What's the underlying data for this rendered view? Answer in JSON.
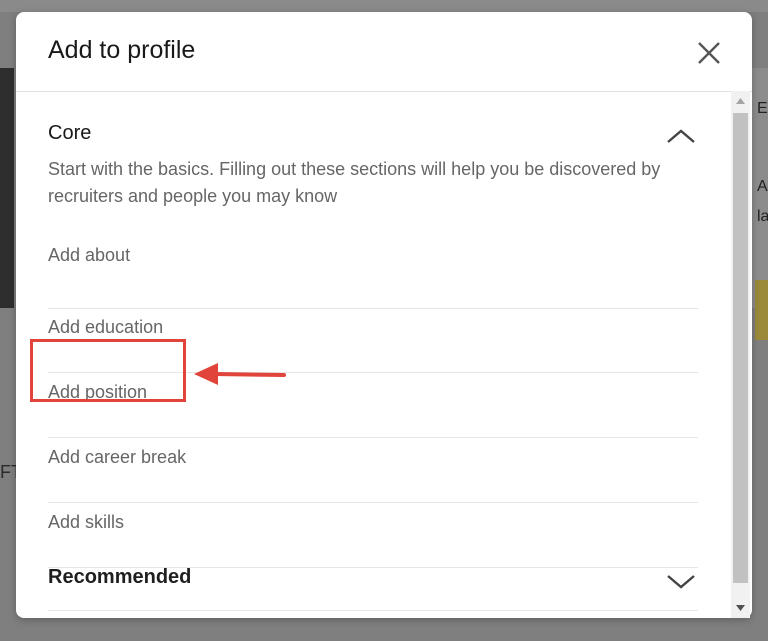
{
  "dialog": {
    "title": "Add to profile",
    "close_icon": "close-icon"
  },
  "core": {
    "title": "Core",
    "description": "Start with the basics. Filling out these sections will help you be discovered by recruiters and people you may know",
    "expanded": true,
    "items": [
      {
        "label": "Add about"
      },
      {
        "label": "Add education"
      },
      {
        "label": "Add position"
      },
      {
        "label": "Add career break"
      },
      {
        "label": "Add skills"
      }
    ]
  },
  "recommended": {
    "title": "Recommended",
    "expanded": false
  },
  "annotation": {
    "highlighted_item": "Add position",
    "color": "#e0443a"
  },
  "background": {
    "left_fragment": "FT",
    "right_fragments": [
      "E",
      "A",
      "la"
    ]
  }
}
